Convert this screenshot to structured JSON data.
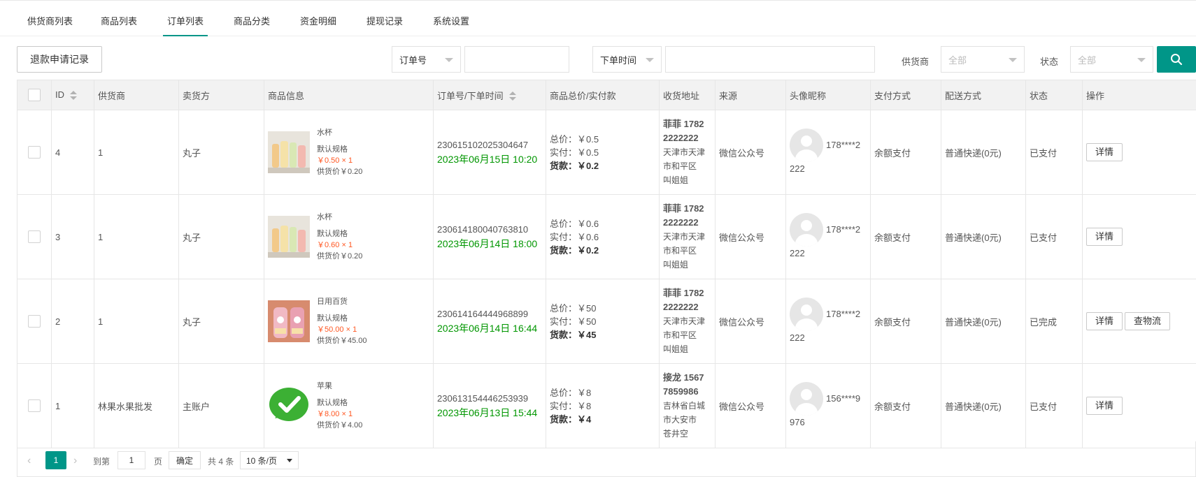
{
  "tabs": [
    {
      "label": "供货商列表"
    },
    {
      "label": "商品列表"
    },
    {
      "label": "订单列表",
      "active": true
    },
    {
      "label": "商品分类"
    },
    {
      "label": "资金明细"
    },
    {
      "label": "提现记录"
    },
    {
      "label": "系统设置"
    }
  ],
  "toolbar": {
    "refund_button": "退款申请记录",
    "search_type": "订单号",
    "search_value": "",
    "time_type": "下单时间",
    "time_value": "",
    "supplier_label": "供货商",
    "supplier_value": "全部",
    "status_label": "状态",
    "status_value": "全部",
    "search_icon": "search-icon",
    "accent": "#009688"
  },
  "table": {
    "headers": [
      "ID",
      "供货商",
      "卖货方",
      "商品信息",
      "订单号/下单时间",
      "商品总价/实付款",
      "收货地址",
      "来源",
      "头像昵称",
      "支付方式",
      "配送方式",
      "状态",
      "操作"
    ],
    "rows": [
      {
        "id": "4",
        "supplier": "1",
        "seller": "丸子",
        "product": {
          "name": "水杯",
          "spec": "默认规格",
          "price": "￥0.50 × 1",
          "supply": "供货价￥0.20",
          "thumb": "cups"
        },
        "order_no": "230615102025304647",
        "order_time": "2023年06月15日 10:20",
        "total": "总价：￥0.5",
        "paid": "实付：￥0.5",
        "goods_label": "货款：",
        "goods_value": "￥0.2",
        "addr_name": "菲菲 1782",
        "addr_phone": "2222222",
        "addr_detail": "天津市天津市和平区 叫姐姐",
        "source": "微信公众号",
        "nickname_a": "178****2",
        "nickname_b": "222",
        "pay": "余额支付",
        "ship": "普通快递(0元)",
        "status": "已支付",
        "status_type": "paid",
        "actions": [
          "详情"
        ]
      },
      {
        "id": "3",
        "supplier": "1",
        "seller": "丸子",
        "product": {
          "name": "水杯",
          "spec": "默认规格",
          "price": "￥0.60 × 1",
          "supply": "供货价￥0.20",
          "thumb": "cups"
        },
        "order_no": "230614180040763810",
        "order_time": "2023年06月14日 18:00",
        "total": "总价：￥0.6",
        "paid": "实付：￥0.6",
        "goods_label": "货款：",
        "goods_value": "￥0.2",
        "addr_name": "菲菲 1782",
        "addr_phone": "2222222",
        "addr_detail": "天津市天津市和平区 叫姐姐",
        "source": "微信公众号",
        "nickname_a": "178****2",
        "nickname_b": "222",
        "pay": "余额支付",
        "ship": "普通快递(0元)",
        "status": "已支付",
        "status_type": "paid",
        "actions": [
          "详情"
        ]
      },
      {
        "id": "2",
        "supplier": "1",
        "seller": "丸子",
        "product": {
          "name": "日用百货",
          "spec": "默认规格",
          "price": "￥50.00 × 1",
          "supply": "供货价￥45.00",
          "thumb": "bottles"
        },
        "order_no": "230614164444968899",
        "order_time": "2023年06月14日 16:44",
        "total": "总价：￥50",
        "paid": "实付：￥50",
        "goods_label": "货款：",
        "goods_value": "￥45",
        "addr_name": "菲菲 1782",
        "addr_phone": "2222222",
        "addr_detail": "天津市天津市和平区 叫姐姐",
        "source": "微信公众号",
        "nickname_a": "178****2",
        "nickname_b": "222",
        "pay": "余额支付",
        "ship": "普通快递(0元)",
        "status": "已完成",
        "status_type": "done",
        "actions": [
          "详情",
          "查物流"
        ]
      },
      {
        "id": "1",
        "supplier": "林果水果批发",
        "seller": "主账户",
        "product": {
          "name": "苹果",
          "spec": "默认规格",
          "price": "￥8.00 × 1",
          "supply": "供货价￥4.00",
          "thumb": "wechat"
        },
        "order_no": "230613154446253939",
        "order_time": "2023年06月13日 15:44",
        "total": "总价：￥8",
        "paid": "实付：￥8",
        "goods_label": "货款：",
        "goods_value": "￥4",
        "addr_name": "接龙 1567",
        "addr_phone": "7859986",
        "addr_detail": "吉林省白城市大安市 苍井空",
        "source": "微信公众号",
        "nickname_a": "156****9",
        "nickname_b": "976",
        "pay": "余额支付",
        "ship": "普通快递(0元)",
        "status": "已支付",
        "status_type": "paid",
        "actions": [
          "详情"
        ]
      }
    ]
  },
  "pager": {
    "prev": "‹",
    "next": "›",
    "current": "1",
    "goto_label": "到第",
    "goto_value": "1",
    "page_label": "页",
    "confirm": "确定",
    "total": "共 4 条",
    "page_size": "10 条/页"
  }
}
